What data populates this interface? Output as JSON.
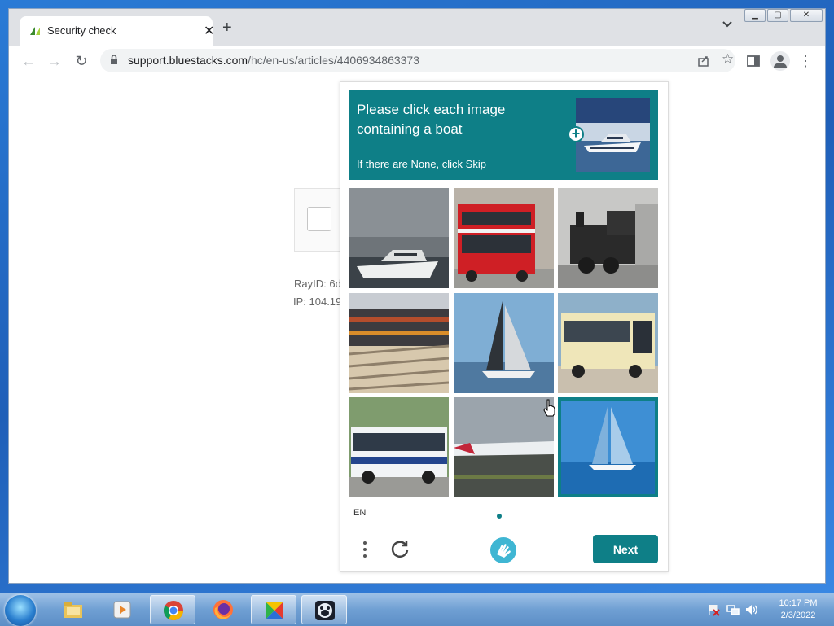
{
  "browser": {
    "tab": {
      "title": "Security check"
    },
    "url": {
      "host": "support.bluestacks.com",
      "path": "/hc/en-us/articles/4406934863373"
    }
  },
  "page": {
    "ray_id": "RayID: 6d",
    "ip": "IP: 104.19"
  },
  "captcha": {
    "prompt": "Please click each image containing a boat",
    "sub_prompt": "If there are None, click Skip",
    "language": "EN",
    "next_label": "Next",
    "tiles": [
      {
        "name": "tile-boat-yacht",
        "selected": false
      },
      {
        "name": "tile-red-bus",
        "selected": false
      },
      {
        "name": "tile-train-locomotive",
        "selected": false
      },
      {
        "name": "tile-train-freight",
        "selected": false
      },
      {
        "name": "tile-sailboat",
        "selected": false
      },
      {
        "name": "tile-yellow-bus",
        "selected": false
      },
      {
        "name": "tile-white-bus",
        "selected": false
      },
      {
        "name": "tile-airplane",
        "selected": false
      },
      {
        "name": "tile-sailboat-blue",
        "selected": true
      }
    ],
    "accent_color": "#0e7f87"
  },
  "taskbar": {
    "apps": [
      "file-explorer-icon",
      "media-player-icon",
      "chrome-icon",
      "firefox-icon",
      "app-icon",
      "bluestacks-icon"
    ],
    "clock_time": "10:17 PM",
    "clock_date": "2/3/2022"
  }
}
